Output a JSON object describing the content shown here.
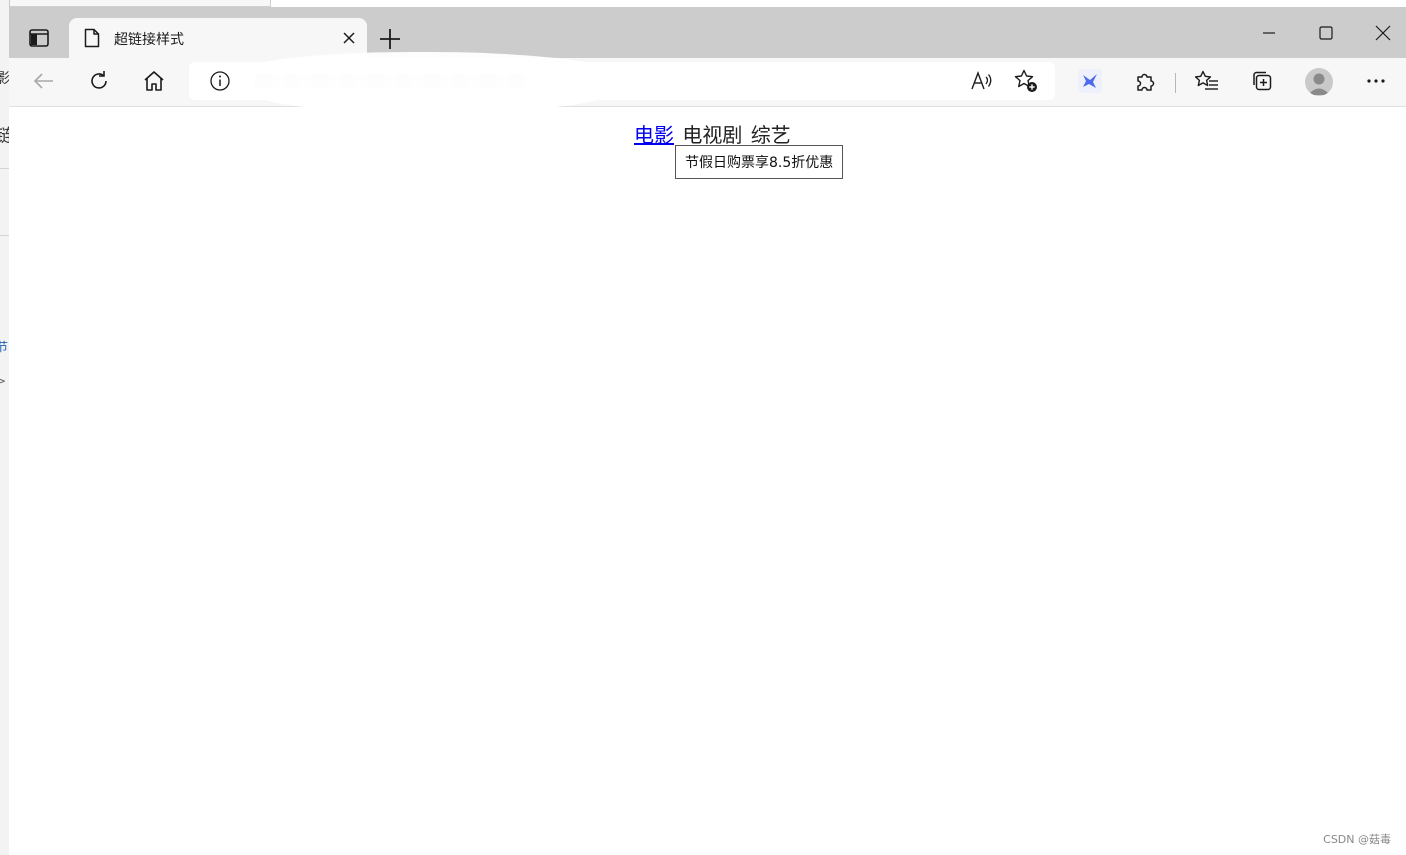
{
  "background_window": {
    "fragments": [
      "影",
      "链",
      "节",
      ">"
    ]
  },
  "tab": {
    "title": "超链接样式"
  },
  "page": {
    "nav": {
      "movie_link": "电影",
      "tv": "电视剧",
      "variety": "综艺"
    },
    "tooltip": "节假日购票享8.5折优惠"
  },
  "watermark": "CSDN @菇毒",
  "colors": {
    "link": "#0000ee",
    "tabbar": "#cccccc",
    "toolbar": "#f7f7f7",
    "extension_accent": "#4f6bed"
  },
  "icons": {
    "tab_actions": "tab-actions-icon",
    "tab_doc": "document-icon",
    "tab_close": "close-icon",
    "new_tab": "plus-icon",
    "minimize": "minimize-icon",
    "maximize": "maximize-icon",
    "close_window": "close-icon",
    "back": "back-arrow-icon",
    "refresh": "refresh-icon",
    "home": "home-icon",
    "site_info": "info-icon",
    "read_aloud": "read-aloud-icon",
    "add_favorite": "star-plus-icon",
    "extension": "bird-extension-icon",
    "extensions": "puzzle-icon",
    "favorites": "favorites-icon",
    "collections": "collections-icon",
    "profile": "profile-avatar-icon",
    "more": "more-icon"
  }
}
